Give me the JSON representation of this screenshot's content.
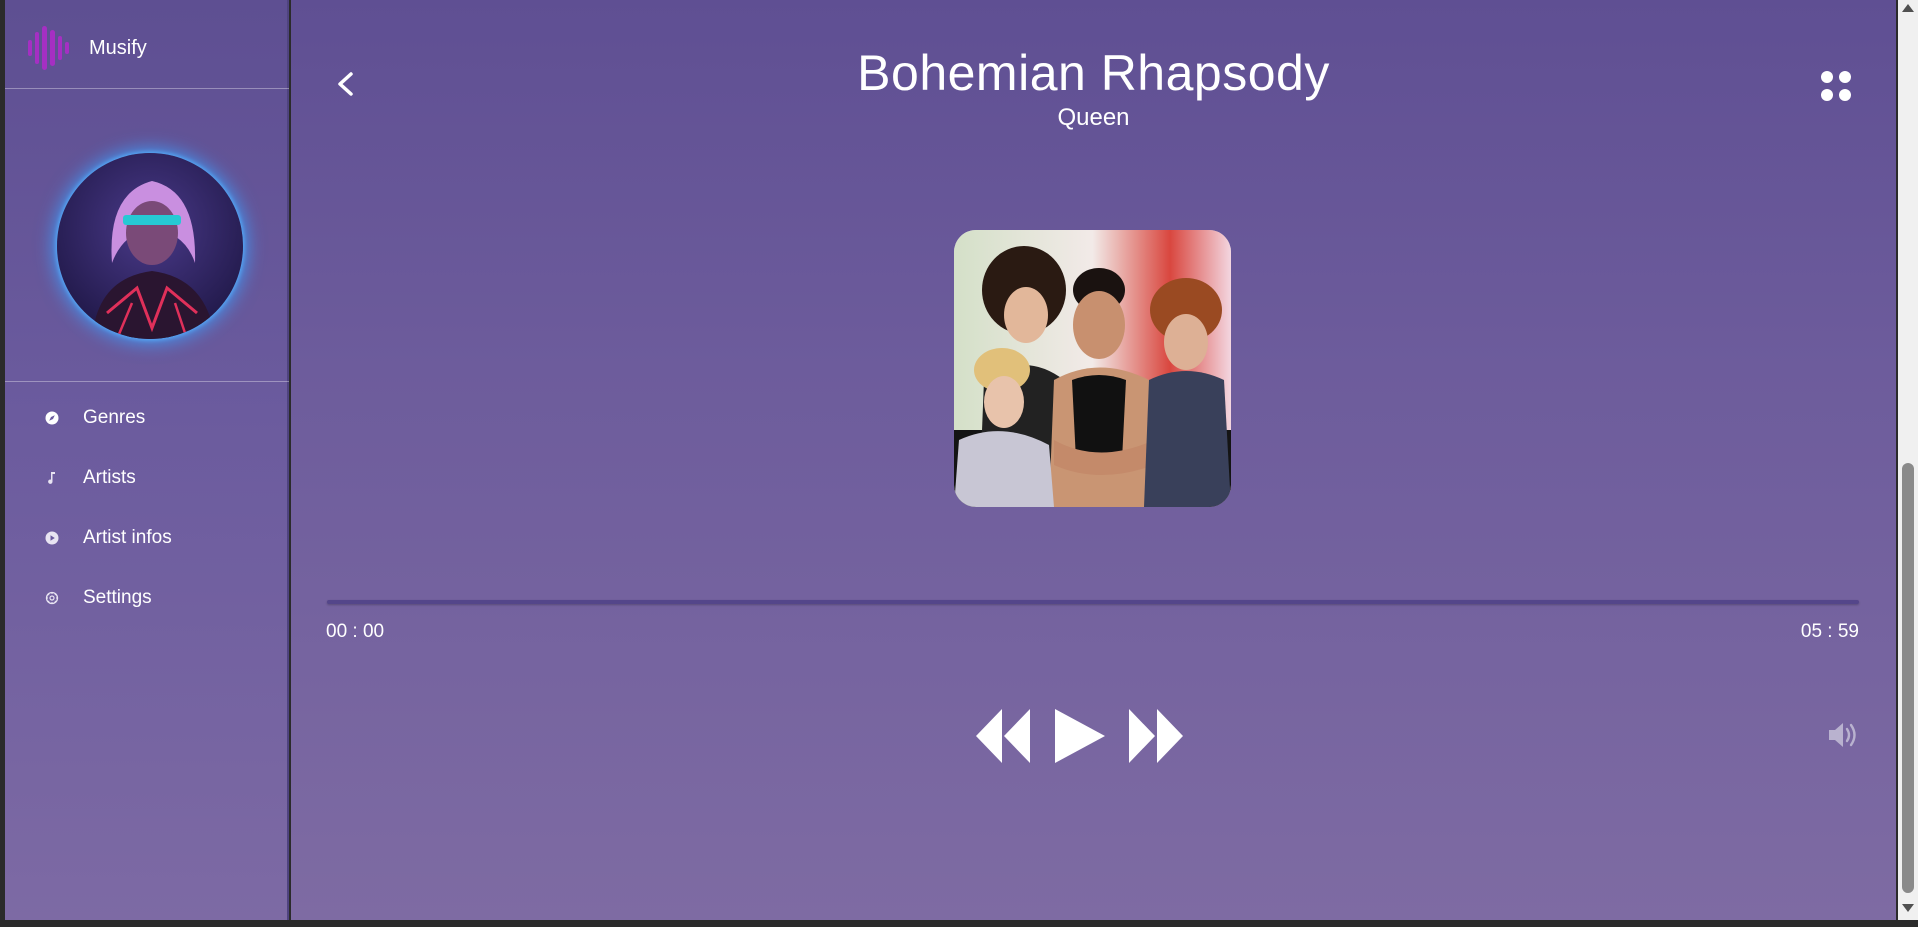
{
  "app": {
    "name": "Musify",
    "accent": "#b03cc8"
  },
  "sidebar": {
    "items": [
      {
        "label": "Genres",
        "icon": "compass-icon"
      },
      {
        "label": "Artists",
        "icon": "music-note-icon"
      },
      {
        "label": "Artist infos",
        "icon": "play-circle-icon"
      },
      {
        "label": "Settings",
        "icon": "gear-icon"
      }
    ]
  },
  "player": {
    "title": "Bohemian Rhapsody",
    "artist": "Queen",
    "elapsed": "00 : 00",
    "duration": "05 : 59",
    "progress_fraction": 0
  },
  "colors": {
    "background_top": "#5f4f93",
    "background_bottom": "#7e6ba3",
    "avatar_glow": "#3ca0ff"
  }
}
